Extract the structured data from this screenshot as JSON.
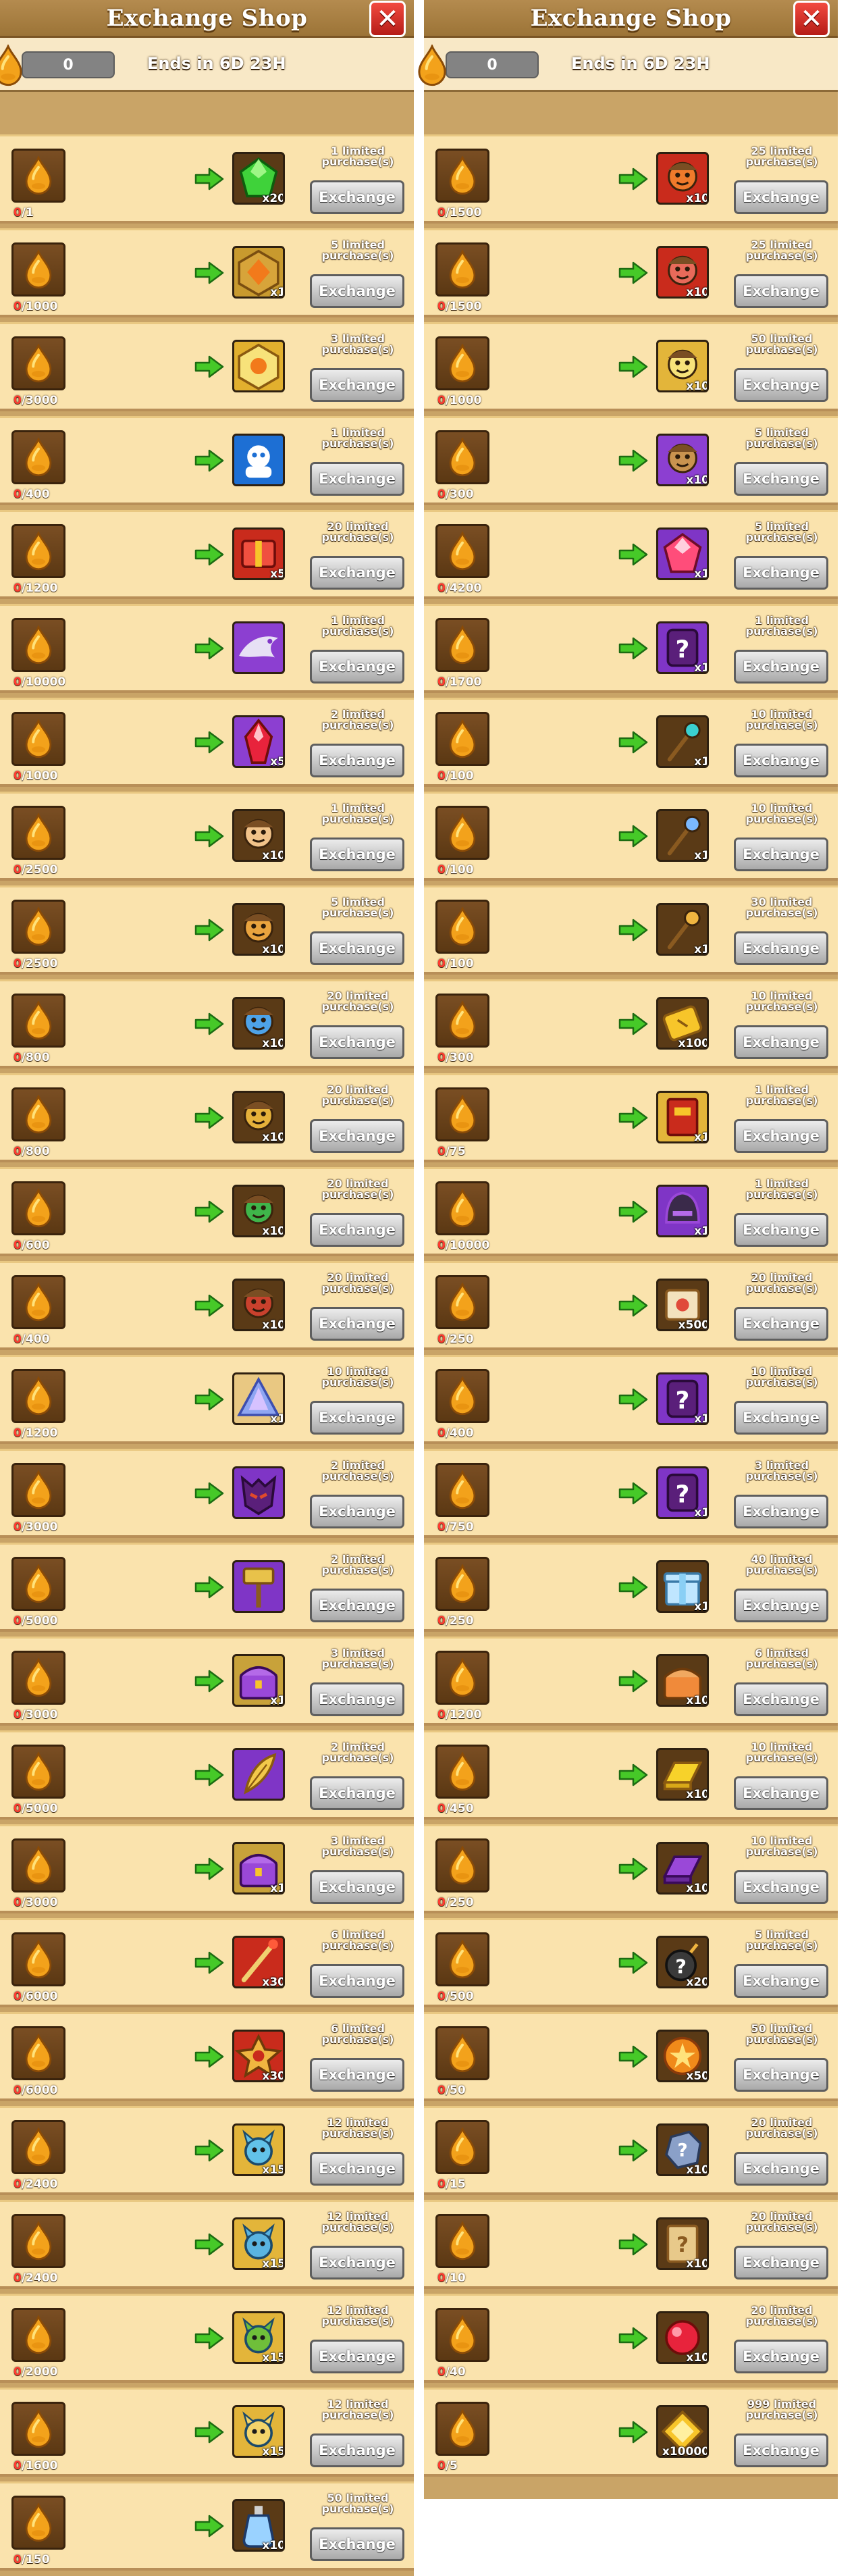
{
  "shop": {
    "title": "Exchange Shop",
    "currency_amount": "0",
    "ends_in": "Ends in 6D 23H",
    "exchange_label": "Exchange"
  },
  "colors": {
    "frame": "#c9a467",
    "row_bg": "#fae3ad",
    "button_gray": "#a9a9a9",
    "arrow_green": "#46c928",
    "have_red": "#ff3b30"
  },
  "left_items": [
    {
      "have": "0",
      "need": "/1",
      "qty": "x20",
      "limit": "1 limited purchase(s)",
      "icon": "green-gem",
      "bg": "#5a3a16",
      "fg": "#3fd23a"
    },
    {
      "have": "0",
      "need": "/1000",
      "qty": "x1",
      "limit": "5 limited purchase(s)",
      "icon": "orange-gem-badge",
      "bg": "#c89a2e",
      "fg": "#f27a1b"
    },
    {
      "have": "0",
      "need": "/3000",
      "qty": "",
      "limit": "3 limited purchase(s)",
      "icon": "gold-badge",
      "bg": "#e2b02e",
      "fg": "#f7e27a"
    },
    {
      "have": "0",
      "need": "/400",
      "qty": "",
      "limit": "1 limited purchase(s)",
      "icon": "blue-hero-card",
      "bg": "#1d6fd4",
      "fg": "#ffffff"
    },
    {
      "have": "0",
      "need": "/1200",
      "qty": "x5",
      "limit": "20 limited purchase(s)",
      "icon": "red-box",
      "bg": "#c92b1c",
      "fg": "#f05040"
    },
    {
      "have": "0",
      "need": "/10000",
      "qty": "",
      "limit": "1 limited purchase(s)",
      "icon": "purple-dragon",
      "bg": "#8c3fd1",
      "fg": "#e7e0f5"
    },
    {
      "have": "0",
      "need": "/1000",
      "qty": "x5",
      "limit": "2 limited purchase(s)",
      "icon": "red-crystal",
      "bg": "#8c3fd1",
      "fg": "#e8233c"
    },
    {
      "have": "0",
      "need": "/2500",
      "qty": "x10",
      "limit": "1 limited purchase(s)",
      "icon": "hero-shard",
      "bg": "#5a3a16",
      "fg": "#f1c38a"
    },
    {
      "have": "0",
      "need": "/2500",
      "qty": "x10",
      "limit": "5 limited purchase(s)",
      "icon": "hero-shard",
      "bg": "#5a3a16",
      "fg": "#e9a33e"
    },
    {
      "have": "0",
      "need": "/800",
      "qty": "x10",
      "limit": "20 limited purchase(s)",
      "icon": "hero-shard",
      "bg": "#5a3a16",
      "fg": "#4ea3e8"
    },
    {
      "have": "0",
      "need": "/800",
      "qty": "x10",
      "limit": "20 limited purchase(s)",
      "icon": "hero-shard",
      "bg": "#5a3a16",
      "fg": "#e5b13a"
    },
    {
      "have": "0",
      "need": "/600",
      "qty": "x10",
      "limit": "20 limited purchase(s)",
      "icon": "hero-shard",
      "bg": "#5a3a16",
      "fg": "#3fb54a"
    },
    {
      "have": "0",
      "need": "/400",
      "qty": "x10",
      "limit": "20 limited purchase(s)",
      "icon": "hero-shard",
      "bg": "#5a3a16",
      "fg": "#c9412d"
    },
    {
      "have": "0",
      "need": "/1200",
      "qty": "x1",
      "limit": "10 limited purchase(s)",
      "icon": "crystal-prism",
      "bg": "#e9c882",
      "fg": "#8fa6f2"
    },
    {
      "have": "0",
      "need": "/3000",
      "qty": "",
      "limit": "2 limited purchase(s)",
      "icon": "purple-mask",
      "bg": "#7f35c6",
      "fg": "#e04a2b"
    },
    {
      "have": "0",
      "need": "/5000",
      "qty": "",
      "limit": "2 limited purchase(s)",
      "icon": "purple-hammer",
      "bg": "#7f35c6",
      "fg": "#e8c24a"
    },
    {
      "have": "0",
      "need": "/3000",
      "qty": "x1",
      "limit": "3 limited purchase(s)",
      "icon": "purple-chest",
      "bg": "#c8a23a",
      "fg": "#9a48d8"
    },
    {
      "have": "0",
      "need": "/5000",
      "qty": "",
      "limit": "2 limited purchase(s)",
      "icon": "purple-feather",
      "bg": "#7f35c6",
      "fg": "#f2c84a"
    },
    {
      "have": "0",
      "need": "/3000",
      "qty": "x1",
      "limit": "3 limited purchase(s)",
      "icon": "purple-chest",
      "bg": "#c8a23a",
      "fg": "#9a48d8"
    },
    {
      "have": "0",
      "need": "/6000",
      "qty": "x30",
      "limit": "6 limited purchase(s)",
      "icon": "red-staff",
      "bg": "#c92b1c",
      "fg": "#f0d070"
    },
    {
      "have": "0",
      "need": "/6000",
      "qty": "x30",
      "limit": "6 limited purchase(s)",
      "icon": "red-relic",
      "bg": "#c92b1c",
      "fg": "#f0b540"
    },
    {
      "have": "0",
      "need": "/2400",
      "qty": "x15",
      "limit": "12 limited purchase(s)",
      "icon": "pet-shard",
      "bg": "#e3b53a",
      "fg": "#62c2e8"
    },
    {
      "have": "0",
      "need": "/2400",
      "qty": "x15",
      "limit": "12 limited purchase(s)",
      "icon": "pet-shard",
      "bg": "#e3b53a",
      "fg": "#5ab4e0"
    },
    {
      "have": "0",
      "need": "/2000",
      "qty": "x15",
      "limit": "12 limited purchase(s)",
      "icon": "pet-shard",
      "bg": "#e3b53a",
      "fg": "#6fbf3a"
    },
    {
      "have": "0",
      "need": "/1600",
      "qty": "x15",
      "limit": "12 limited purchase(s)",
      "icon": "pet-shard",
      "bg": "#e3b53a",
      "fg": "#f3d46a"
    },
    {
      "have": "0",
      "need": "/150",
      "qty": "x10",
      "limit": "50 limited purchase(s)",
      "icon": "potion",
      "bg": "#5a3a16",
      "fg": "#9ad2ff"
    }
  ],
  "right_items": [
    {
      "have": "0",
      "need": "/1500",
      "qty": "x10",
      "limit": "25 limited purchase(s)",
      "icon": "hero-shard",
      "bg": "#c92b1c",
      "fg": "#f07a2b"
    },
    {
      "have": "0",
      "need": "/1500",
      "qty": "x10",
      "limit": "25 limited purchase(s)",
      "icon": "hero-shard",
      "bg": "#c92b1c",
      "fg": "#e86a5a"
    },
    {
      "have": "0",
      "need": "/1000",
      "qty": "x10",
      "limit": "50 limited purchase(s)",
      "icon": "hero-shard",
      "bg": "#e3b53a",
      "fg": "#f7e27a"
    },
    {
      "have": "0",
      "need": "/300",
      "qty": "x10",
      "limit": "5 limited purchase(s)",
      "icon": "hero-shard",
      "bg": "#8c3fd1",
      "fg": "#c9934f"
    },
    {
      "have": "0",
      "need": "/4200",
      "qty": "x1",
      "limit": "5 limited purchase(s)",
      "icon": "pink-gem",
      "bg": "#7f35c6",
      "fg": "#ff4d7a"
    },
    {
      "have": "0",
      "need": "/1700",
      "qty": "x1",
      "limit": "1 limited purchase(s)",
      "icon": "mystery-card",
      "bg": "#7f35c6",
      "fg": "#ffffff"
    },
    {
      "have": "0",
      "need": "/100",
      "qty": "x1",
      "limit": "10 limited purchase(s)",
      "icon": "wand",
      "bg": "#5a3a16",
      "fg": "#3ad0d0"
    },
    {
      "have": "0",
      "need": "/100",
      "qty": "x1",
      "limit": "10 limited purchase(s)",
      "icon": "wand",
      "bg": "#5a3a16",
      "fg": "#7ab8ff"
    },
    {
      "have": "0",
      "need": "/100",
      "qty": "x1",
      "limit": "30 limited purchase(s)",
      "icon": "wand",
      "bg": "#5a3a16",
      "fg": "#f0b540"
    },
    {
      "have": "0",
      "need": "/300",
      "qty": "x100",
      "limit": "10 limited purchase(s)",
      "icon": "gold-ticket",
      "bg": "#5a3a16",
      "fg": "#f7c52a"
    },
    {
      "have": "0",
      "need": "/75",
      "qty": "x1",
      "limit": "1 limited purchase(s)",
      "icon": "red-book",
      "bg": "#e3b53a",
      "fg": "#c92b1c"
    },
    {
      "have": "0",
      "need": "/10000",
      "qty": "x1",
      "limit": "1 limited purchase(s)",
      "icon": "purple-helmet",
      "bg": "#7f35c6",
      "fg": "#3a2a4a"
    },
    {
      "have": "0",
      "need": "/250",
      "qty": "x500",
      "limit": "20 limited purchase(s)",
      "icon": "scroll",
      "bg": "#5a3a16",
      "fg": "#f3e2bd"
    },
    {
      "have": "0",
      "need": "/400",
      "qty": "x1",
      "limit": "10 limited purchase(s)",
      "icon": "mystery-card",
      "bg": "#7f35c6",
      "fg": "#ffffff"
    },
    {
      "have": "0",
      "need": "/750",
      "qty": "x1",
      "limit": "3 limited purchase(s)",
      "icon": "mystery-card",
      "bg": "#7f35c6",
      "fg": "#ffffff"
    },
    {
      "have": "0",
      "need": "/250",
      "qty": "x1",
      "limit": "40 limited purchase(s)",
      "icon": "ice-gift",
      "bg": "#5a3a16",
      "fg": "#bfe6ff"
    },
    {
      "have": "0",
      "need": "/1200",
      "qty": "x10",
      "limit": "6 limited purchase(s)",
      "icon": "orange-chest",
      "bg": "#5a3a16",
      "fg": "#f08a3a"
    },
    {
      "have": "0",
      "need": "/450",
      "qty": "x10",
      "limit": "10 limited purchase(s)",
      "icon": "gold-bar",
      "bg": "#5a3a16",
      "fg": "#f7d22a"
    },
    {
      "have": "0",
      "need": "/250",
      "qty": "x10",
      "limit": "10 limited purchase(s)",
      "icon": "purple-bar",
      "bg": "#5a3a16",
      "fg": "#9a48d8"
    },
    {
      "have": "0",
      "need": "/500",
      "qty": "x20",
      "limit": "5 limited purchase(s)",
      "icon": "mystery-bomb",
      "bg": "#5a3a16",
      "fg": "#3a3a3a"
    },
    {
      "have": "0",
      "need": "/50",
      "qty": "x50",
      "limit": "50 limited purchase(s)",
      "icon": "star-medal",
      "bg": "#5a3a16",
      "fg": "#f08a1a"
    },
    {
      "have": "0",
      "need": "/15",
      "qty": "x10",
      "limit": "20 limited purchase(s)",
      "icon": "stone",
      "bg": "#5a3a16",
      "fg": "#8aa0c8"
    },
    {
      "have": "0",
      "need": "/10",
      "qty": "x10",
      "limit": "20 limited purchase(s)",
      "icon": "mystery-scroll",
      "bg": "#5a3a16",
      "fg": "#e8c98a"
    },
    {
      "have": "0",
      "need": "/40",
      "qty": "x10",
      "limit": "20 limited purchase(s)",
      "icon": "red-orb",
      "bg": "#5a3a16",
      "fg": "#e8233c"
    },
    {
      "have": "0",
      "need": "/5",
      "qty": "x10000",
      "limit": "999 limited purchase(s)",
      "icon": "gold-coin",
      "bg": "#5a3a16",
      "fg": "#f7c52a"
    }
  ]
}
